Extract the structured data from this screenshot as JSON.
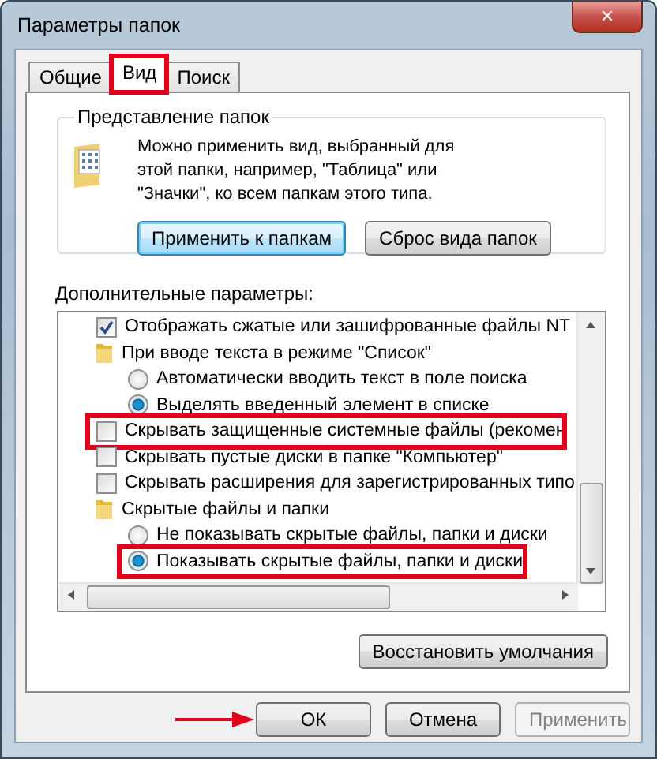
{
  "window": {
    "title": "Параметры папок",
    "close": "✕"
  },
  "tabs": [
    {
      "label": "Общие",
      "selected": false,
      "highlighted": false
    },
    {
      "label": "Вид",
      "selected": true,
      "highlighted": true
    },
    {
      "label": "Поиск",
      "selected": false,
      "highlighted": false
    }
  ],
  "folder_views": {
    "title": "Представление папок",
    "description": "Можно применить вид, выбранный для этой папки, например, \"Таблица\" или \"Значки\", ко всем папкам этого типа.",
    "buttons": [
      {
        "label": "Применить к папкам",
        "focused": true
      },
      {
        "label": "Сброс вида папок",
        "focused": false
      }
    ]
  },
  "advanced": {
    "title": "Дополнительные параметры:",
    "items": [
      {
        "kind": "checkbox",
        "label": "Отображать сжатые или зашифрованные файлы NT",
        "checked": true,
        "highlighted": false
      },
      {
        "kind": "folder",
        "label": "При вводе текста в режиме \"Список\"",
        "children": [
          {
            "kind": "radio",
            "label": "Автоматически вводить текст в поле поиска",
            "selected": false,
            "highlighted": false
          },
          {
            "kind": "radio",
            "label": "Выделять введенный элемент в списке",
            "selected": true,
            "highlighted": false
          }
        ]
      },
      {
        "kind": "checkbox",
        "label": "Скрывать защищенные системные файлы (рекомен",
        "checked": false,
        "highlighted": true
      },
      {
        "kind": "checkbox",
        "label": "Скрывать пустые диски в папке \"Компьютер\"",
        "checked": false,
        "highlighted": false
      },
      {
        "kind": "checkbox",
        "label": "Скрывать расширения для зарегистрированных типо",
        "checked": false,
        "highlighted": false
      },
      {
        "kind": "folder",
        "label": "Скрытые файлы и папки",
        "children": [
          {
            "kind": "radio",
            "label": "Не показывать скрытые файлы, папки и диски",
            "selected": false,
            "highlighted": false
          },
          {
            "kind": "radio",
            "label": "Показывать скрытые файлы, папки и диски",
            "selected": true,
            "highlighted": true
          }
        ]
      }
    ],
    "restore_button": "Восстановить умолчания"
  },
  "buttons": [
    {
      "label": "ОК",
      "disabled": false,
      "arrow": true
    },
    {
      "label": "Отмена",
      "disabled": false,
      "arrow": false
    },
    {
      "label": "Применить",
      "disabled": true,
      "arrow": false
    }
  ]
}
